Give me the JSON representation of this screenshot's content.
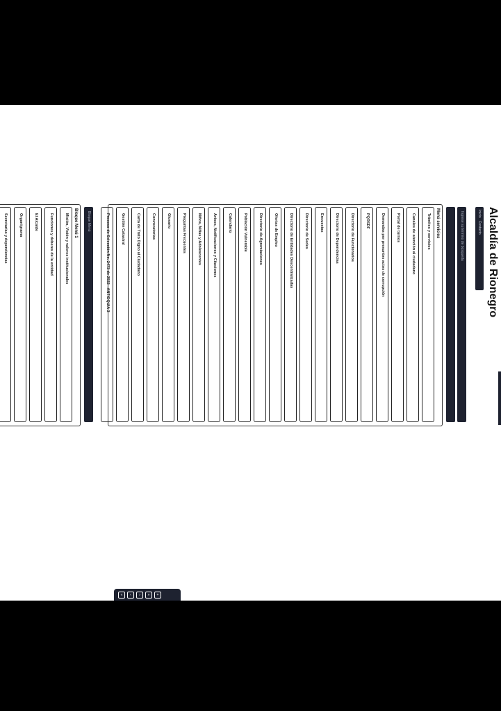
{
  "header": {
    "title": "Alcaldía de Rionegro",
    "top_buttons": [
      "Inicio",
      "Contacto"
    ]
  },
  "search_bar": {
    "label": "Ingrese su término de búsqueda"
  },
  "menu_services": {
    "heading": "Menú servicios",
    "items": [
      "Trámites y servicios",
      "Canales de atención al ciudadano",
      "Portal de turnos",
      "Demandas por presuntos actos de corrupción",
      "PQRSDF",
      "Directorio de Funcionarios",
      "Directorio de Dependencias",
      "Encuestas",
      "Directorio de Sedes",
      "Directorio de Entidades Descentralizadas",
      "Ofertas de Empleo",
      "Directorio de Agremiaciones",
      "Población Vulnerable",
      "Calendario",
      "Avisos, Notificaciones y Citaciones",
      "Niños, Niñas y Adolescentes",
      "Preguntas Frecuentes",
      "Glosario",
      "Convocatorias",
      "Carta de Trato Digno al Ciudadano",
      "Gestión Catastral",
      "Proceso de Selección No. 2473 de 2022 - ANTIOQUIA 3"
    ]
  },
  "menu_block": {
    "bar_label": "Bloque Menú",
    "heading": "Bloque Menú 1",
    "items": [
      "Misión, Visión y valores institucionales",
      "Funciones y deberes de la entidad",
      "El Alcalde",
      "Organigrama",
      "Secretarías y dependencias"
    ]
  },
  "thumb_controls": [
    "first",
    "prev",
    "next",
    "last",
    "zoom"
  ]
}
